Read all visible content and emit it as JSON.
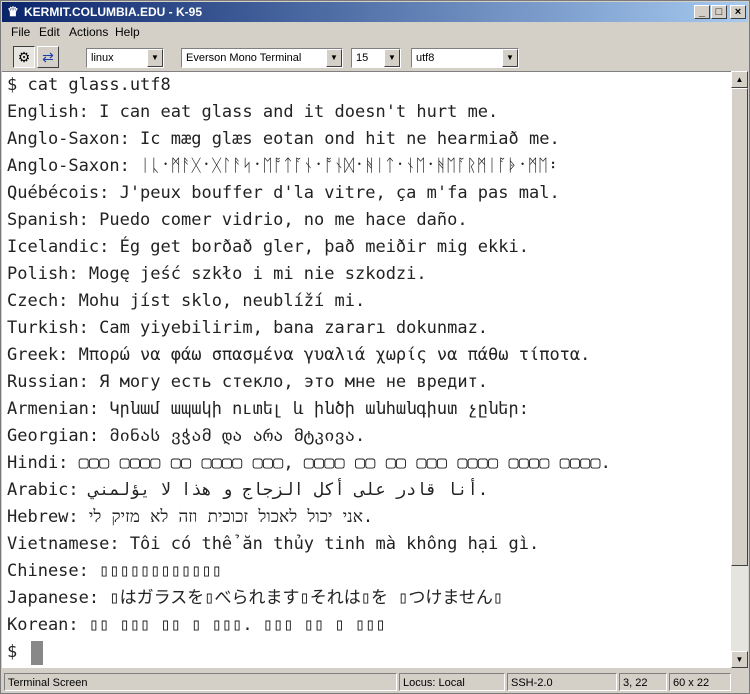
{
  "window": {
    "title": "KERMIT.COLUMBIA.EDU - K-95",
    "icons": [
      "app-icon",
      "minimize-icon",
      "maximize-icon",
      "close-icon"
    ]
  },
  "menu": [
    "File",
    "Edit",
    "Actions",
    "Help"
  ],
  "toolbar": {
    "terminal_type": "linux",
    "font_name": "Everson Mono Terminal",
    "font_size": "15",
    "charset": "utf8"
  },
  "terminal": {
    "lines": [
      "$ cat glass.utf8",
      "English: I can eat glass and it doesn't hurt me.",
      "Anglo-Saxon: Ic mæg glæs eotan ond hit ne hearmiað me.",
      "Anglo-Saxon: ᛁᚳ᛫ᛗᚨᚷ᛫ᚷᛚᚨᛋ᛫ᛖᚩᛏᚪᚾ᛫ᚩᚾᛞ᛫ᚻᛁᛏ᛫ᚾᛖ᛫ᚻᛖᚪᚱᛗᛁᚪᚧ᛫ᛗᛖ᛬",
      "Québécois: J'peux bouffer d'la vitre, ça m'fa pas mal.",
      "Spanish: Puedo comer vidrio, no me hace daño.",
      "Icelandic: Ég get borðað gler, það meiðir mig ekki.",
      "Polish: Mogę jeść szkło i mi nie szkodzi.",
      "Czech: Mohu jíst sklo, neublíží mi.",
      "Turkish: Cam yiyebilirim, bana zararı dokunmaz.",
      "Greek: Μπορώ να φάω σπασμένα γυαλιά χωρίς να πάθω τίποτα.",
      "Russian: Я могу есть стекло, это мне не вредит.",
      "Armenian: Կրնամ ապակի ուտել և ինծի անհանգիստ չըներ:",
      "Georgian: მინას ვჭამ და არა მტკივა.",
      "Hindi: ▢▢▢ ▢▢▢▢ ▢▢ ▢▢▢▢ ▢▢▢, ▢▢▢▢ ▢▢ ▢▢ ▢▢▢ ▢▢▢▢ ▢▢▢▢ ▢▢▢▢.",
      "Arabic: أنا قادر على أكل الزجاج و هذا لا يؤلمني.",
      "Hebrew: אני יכול לאכול זכוכית וזה לא מזיק לי.",
      "Vietnamese: Tôi có thể ăn thủy tinh mà không hại gì.",
      "Chinese: ▯▯▯▯▯▯▯▯▯▯▯▯",
      "Japanese: ▯はガラスを▯べられます▯それは▯を ▯つけません▯",
      "Korean: ▯▯ ▯▯▯ ▯▯ ▯ ▯▯▯. ▯▯▯ ▯▯ ▯ ▯▯▯",
      "$"
    ]
  },
  "scrollbar": {
    "icons": [
      "scroll-up-icon",
      "scroll-down-icon"
    ]
  },
  "status": {
    "mode": "Terminal Screen",
    "locus": "Locus: Local",
    "protocol": "SSH-2.0",
    "cursor": "3, 22",
    "size": "60 x 22"
  }
}
